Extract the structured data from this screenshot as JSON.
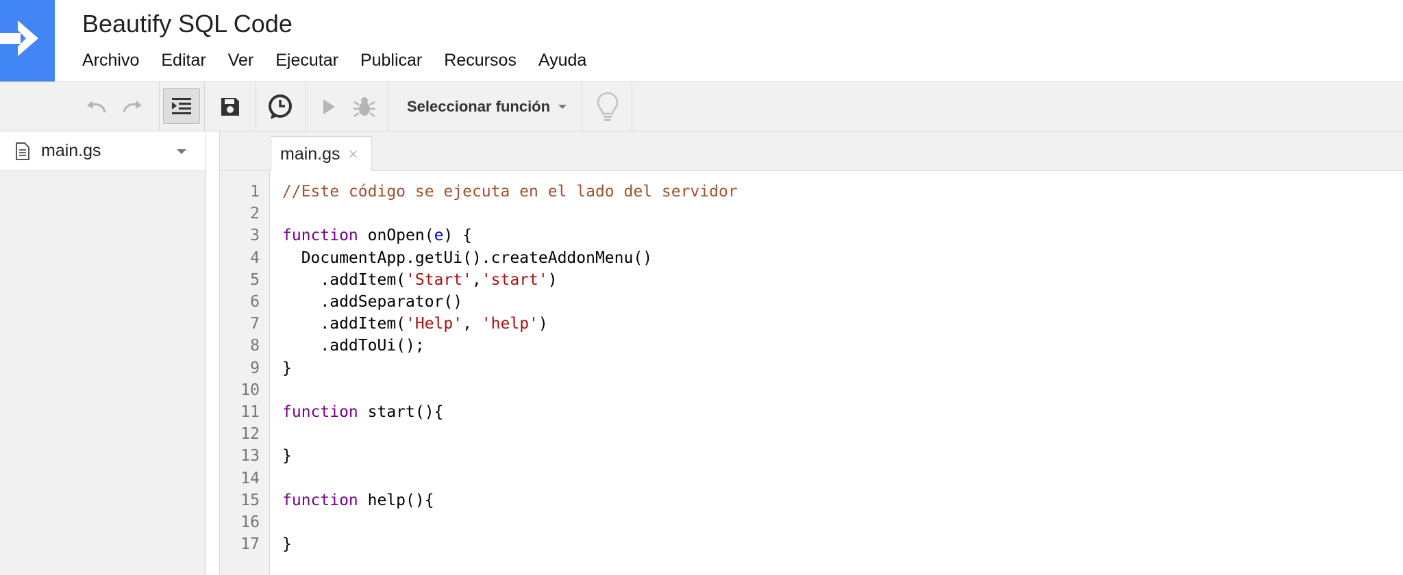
{
  "app": {
    "title": "Beautify SQL Code",
    "logo_icon": "arrow-right-icon",
    "brand_color": "#4285f4"
  },
  "menu": {
    "items": [
      {
        "id": "archivo",
        "label": "Archivo"
      },
      {
        "id": "editar",
        "label": "Editar"
      },
      {
        "id": "ver",
        "label": "Ver"
      },
      {
        "id": "ejecutar",
        "label": "Ejecutar"
      },
      {
        "id": "publicar",
        "label": "Publicar"
      },
      {
        "id": "recursos",
        "label": "Recursos"
      },
      {
        "id": "ayuda",
        "label": "Ayuda"
      }
    ]
  },
  "toolbar": {
    "buttons": [
      "undo-icon",
      "redo-icon",
      "indent-icon",
      "save-icon",
      "triggers-clock-icon",
      "run-icon",
      "debug-bug-icon",
      "lightbulb-icon"
    ],
    "function_select": {
      "label": "Seleccionar función"
    }
  },
  "sidebar": {
    "files": [
      {
        "name": "main.gs",
        "icon": "document-icon"
      }
    ]
  },
  "tabs": [
    {
      "label": "main.gs",
      "close": "×"
    }
  ],
  "editor": {
    "colors": {
      "comment": "#a0522d",
      "keyword": "#770088",
      "string": "#aa1111",
      "variable": "#0000cc"
    },
    "lines": [
      {
        "n": "1",
        "tokens": [
          {
            "t": "comment",
            "v": "//Este código se ejecuta en el lado del servidor"
          }
        ]
      },
      {
        "n": "2",
        "tokens": []
      },
      {
        "n": "3",
        "tokens": [
          {
            "t": "keyword",
            "v": "function"
          },
          {
            "t": "plain",
            "v": " onOpen("
          },
          {
            "t": "var",
            "v": "e"
          },
          {
            "t": "plain",
            "v": ") {"
          }
        ]
      },
      {
        "n": "4",
        "tokens": [
          {
            "t": "plain",
            "v": "  DocumentApp.getUi().createAddonMenu()"
          }
        ]
      },
      {
        "n": "5",
        "tokens": [
          {
            "t": "plain",
            "v": "    .addItem("
          },
          {
            "t": "string",
            "v": "'Start'"
          },
          {
            "t": "plain",
            "v": ","
          },
          {
            "t": "string",
            "v": "'start'"
          },
          {
            "t": "plain",
            "v": ")"
          }
        ]
      },
      {
        "n": "6",
        "tokens": [
          {
            "t": "plain",
            "v": "    .addSeparator()"
          }
        ]
      },
      {
        "n": "7",
        "tokens": [
          {
            "t": "plain",
            "v": "    .addItem("
          },
          {
            "t": "string",
            "v": "'Help'"
          },
          {
            "t": "plain",
            "v": ", "
          },
          {
            "t": "string",
            "v": "'help'"
          },
          {
            "t": "plain",
            "v": ")"
          }
        ]
      },
      {
        "n": "8",
        "tokens": [
          {
            "t": "plain",
            "v": "    .addToUi();"
          }
        ]
      },
      {
        "n": "9",
        "tokens": [
          {
            "t": "plain",
            "v": "}"
          }
        ]
      },
      {
        "n": "10",
        "tokens": []
      },
      {
        "n": "11",
        "tokens": [
          {
            "t": "keyword",
            "v": "function"
          },
          {
            "t": "plain",
            "v": " start(){"
          }
        ]
      },
      {
        "n": "12",
        "tokens": []
      },
      {
        "n": "13",
        "tokens": [
          {
            "t": "plain",
            "v": "}"
          }
        ]
      },
      {
        "n": "14",
        "tokens": []
      },
      {
        "n": "15",
        "tokens": [
          {
            "t": "keyword",
            "v": "function"
          },
          {
            "t": "plain",
            "v": " help(){"
          }
        ]
      },
      {
        "n": "16",
        "tokens": []
      },
      {
        "n": "17",
        "tokens": [
          {
            "t": "plain",
            "v": "}"
          }
        ]
      }
    ]
  }
}
